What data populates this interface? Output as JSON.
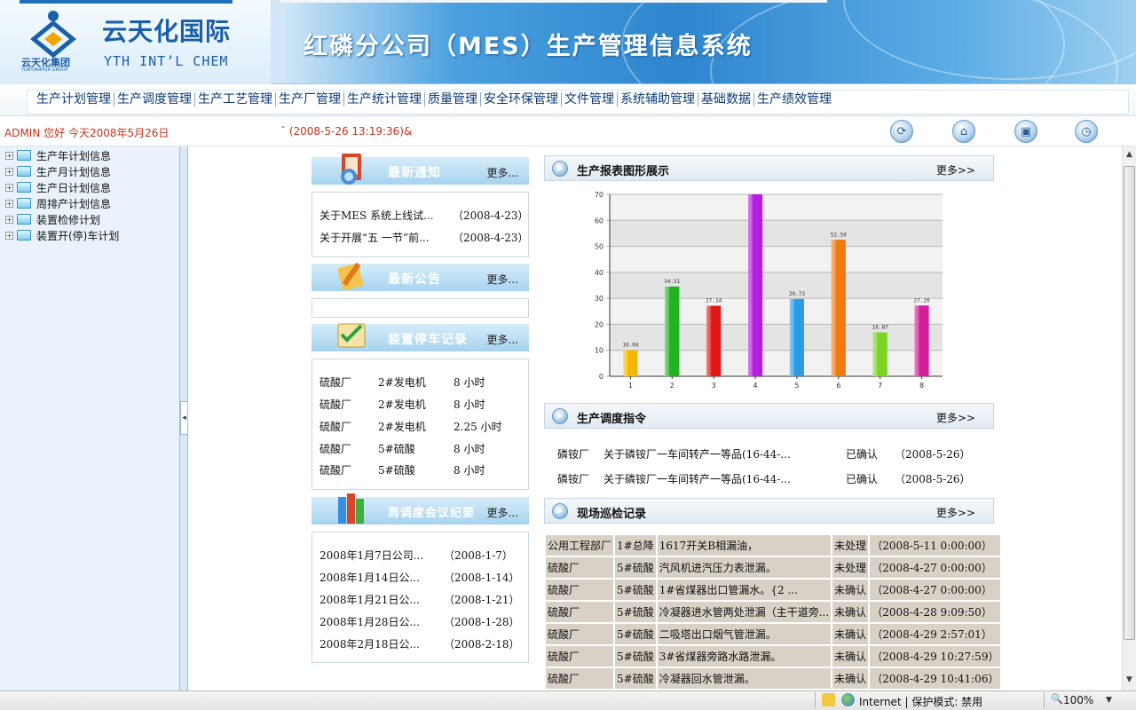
{
  "header": {
    "logo_cn": "云天化国际",
    "logo_en": "YTH INT’L CHEM",
    "logo_group": "云天化集团",
    "logo_group_sub": "YUNTIANHUA GROUP",
    "system_title": "红磷分公司（MES）生产管理信息系统"
  },
  "menu": [
    "生产计划管理",
    "生产调度管理",
    "生产工艺管理",
    "生产厂管理",
    "生产统计管理",
    "质量管理",
    "安全环保管理",
    "文件管理",
    "系统辅助管理",
    "基础数据",
    "生产绩效管理"
  ],
  "status": {
    "greeting": "ADMIN 您好  今天2008年5月26日",
    "clock": "ˉ (2008-5-26 13:19:36)&"
  },
  "toolbar_icons": [
    "refresh-icon",
    "home-icon",
    "lock-icon",
    "clock-icon"
  ],
  "tree": [
    "生产年计划信息",
    "生产月计划信息",
    "生产日计划信息",
    "周排产计划信息",
    "装置检修计划",
    "装置开(停)车计划"
  ],
  "notices": {
    "title": "最新通知",
    "more": "更多...",
    "items": [
      {
        "text": "关于MES 系统上线试...",
        "date": "（2008-4-23）"
      },
      {
        "text": "关于开展“五 一节”前...",
        "date": "（2008-4-23）"
      }
    ]
  },
  "announcements": {
    "title": "最新公告",
    "more": "更多..."
  },
  "shutdowns": {
    "title": "装置停车记录",
    "more": "更多...",
    "rows": [
      {
        "plant": "硫酸厂",
        "unit": "2#发电机",
        "hours": "8 小时"
      },
      {
        "plant": "硫酸厂",
        "unit": "2#发电机",
        "hours": "8 小时"
      },
      {
        "plant": "硫酸厂",
        "unit": "2#发电机",
        "hours": "2.25 小时"
      },
      {
        "plant": "硫酸厂",
        "unit": "5#硫酸",
        "hours": "8 小时"
      },
      {
        "plant": "硫酸厂",
        "unit": "5#硫酸",
        "hours": "8 小时"
      }
    ]
  },
  "meetings": {
    "title": "周调度会议纪要",
    "more": "更多...",
    "items": [
      {
        "text": "2008年1月7日公司...",
        "date": "（2008-1-7）"
      },
      {
        "text": "2008年1月14日公...",
        "date": "（2008-1-14）"
      },
      {
        "text": "2008年1月21日公...",
        "date": "（2008-1-21）"
      },
      {
        "text": "2008年1月28日公...",
        "date": "（2008-1-28）"
      },
      {
        "text": "2008年2月18日公...",
        "date": "（2008-2-18）"
      }
    ]
  },
  "report": {
    "title": "生产报表图形展示",
    "more": "更多>>"
  },
  "chart_data": {
    "type": "bar",
    "categories": [
      "1",
      "2",
      "3",
      "4",
      "5",
      "6",
      "7",
      "8"
    ],
    "values": [
      10.04,
      34.51,
      27.14,
      70,
      29.73,
      52.5,
      16.87,
      27.2
    ],
    "labels": [
      "10.04",
      "34.51",
      "27.14",
      "",
      "29.73",
      "52.50",
      "16.87",
      "27.20"
    ],
    "colors": [
      "#f5b800",
      "#22b322",
      "#e01818",
      "#b51ee0",
      "#2c9ce6",
      "#f07a10",
      "#7ad420",
      "#d61e9a"
    ],
    "ylim": [
      0,
      70
    ],
    "yticks": [
      "0",
      "10",
      "20",
      "30",
      "40",
      "50",
      "60",
      "70"
    ],
    "grid": true
  },
  "dispatch": {
    "title": "生产调度指令",
    "more": "更多>>",
    "rows": [
      {
        "plant": "磷铵厂",
        "text": "关于磷铵厂一车间转产一等品(16-44-...",
        "status": "已确认",
        "date": "（2008-5-26）"
      },
      {
        "plant": "磷铵厂",
        "text": "关于磷铵厂一车间转产一等品(16-44-...",
        "status": "已确认",
        "date": "（2008-5-26）"
      }
    ]
  },
  "patrol": {
    "title": "现场巡检记录",
    "more": "更多>>",
    "rows": [
      {
        "dept": "公用工程部厂",
        "unit": "1#总降",
        "desc": "1617开关B相漏油，",
        "status": "未处理",
        "time": "（2008-5-11 0:00:00）"
      },
      {
        "dept": "硫酸厂",
        "unit": "5#硫酸",
        "desc": "汽风机进汽压力表泄漏。",
        "status": "未处理",
        "time": "（2008-4-27 0:00:00）"
      },
      {
        "dept": "硫酸厂",
        "unit": "5#硫酸",
        "desc": "1#省煤器出口管漏水。{2 ...",
        "status": "未确认",
        "time": "（2008-4-27 0:00:00）"
      },
      {
        "dept": "硫酸厂",
        "unit": "5#硫酸",
        "desc": "冷凝器进水管两处泄漏（主干道旁...",
        "status": "未确认",
        "time": "（2008-4-28 9:09:50）"
      },
      {
        "dept": "硫酸厂",
        "unit": "5#硫酸",
        "desc": "二吸塔出口烟气管泄漏。",
        "status": "未确认",
        "time": "（2008-4-29 2:57:01）"
      },
      {
        "dept": "硫酸厂",
        "unit": "5#硫酸",
        "desc": "3#省煤器旁路水路泄漏。",
        "status": "未确认",
        "time": "（2008-4-29 10:27:59）"
      },
      {
        "dept": "硫酸厂",
        "unit": "5#硫酸",
        "desc": "冷凝器回水管泄漏。",
        "status": "未确认",
        "time": "（2008-4-29 10:41:06）"
      }
    ]
  },
  "browser_status": {
    "zone": "Internet | 保护模式: 禁用",
    "zoom": "100%"
  }
}
